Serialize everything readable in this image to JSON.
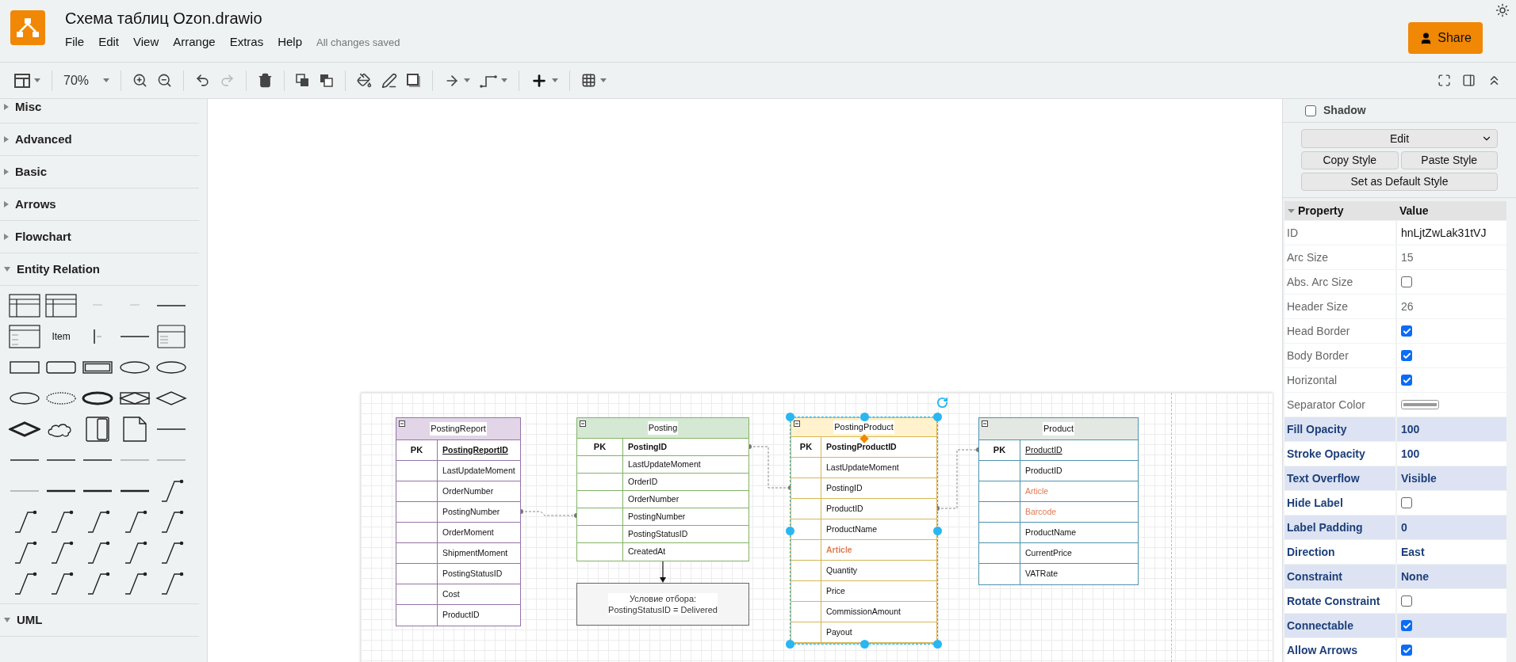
{
  "header": {
    "title": "Схема таблиц Ozon.drawio",
    "menu": [
      "File",
      "Edit",
      "View",
      "Arrange",
      "Extras",
      "Help"
    ],
    "save_status": "All changes saved",
    "share_button": "Share"
  },
  "toolbar": {
    "zoom": "70%",
    "undo": {
      "disabled": false
    },
    "redo": {
      "disabled": true
    }
  },
  "sidebar": {
    "sections": [
      {
        "label": "Misc",
        "expanded": false
      },
      {
        "label": "Advanced",
        "expanded": false
      },
      {
        "label": "Basic",
        "expanded": false
      },
      {
        "label": "Arrows",
        "expanded": false
      },
      {
        "label": "Flowchart",
        "expanded": false
      },
      {
        "label": "Entity Relation",
        "expanded": true,
        "palette_item_label": "Item"
      },
      {
        "label": "UML",
        "expanded": true
      }
    ]
  },
  "canvas": {
    "tables": [
      {
        "title": "PostingReport",
        "header": {
          "color": "#e1d5e7"
        },
        "border": {
          "color": "#9673a6"
        },
        "selected": false,
        "fields": [
          {
            "key": "PK",
            "name": "PostingReportID",
            "bold": true,
            "underline": true,
            "highlighted": false
          },
          {
            "name": "LastUpdateMoment",
            "bold": false,
            "underline": false,
            "highlighted": false
          },
          {
            "name": "OrderNumber",
            "bold": false,
            "underline": false,
            "highlighted": false
          },
          {
            "name": "PostingNumber",
            "bold": false,
            "underline": false,
            "highlighted": false
          },
          {
            "name": "OrderMoment",
            "bold": false,
            "underline": false,
            "highlighted": false
          },
          {
            "name": "ShipmentMoment",
            "bold": false,
            "underline": false,
            "highlighted": false
          },
          {
            "name": "PostingStatusID",
            "bold": false,
            "underline": false,
            "highlighted": false
          },
          {
            "name": "Cost",
            "bold": false,
            "underline": false,
            "highlighted": false
          },
          {
            "name": "ProductID",
            "bold": false,
            "underline": false,
            "highlighted": false
          }
        ]
      },
      {
        "title": "Posting",
        "header": {
          "color": "#d5e8d4"
        },
        "border": {
          "color": "#82b366"
        },
        "selected": false,
        "fields": [
          {
            "key": "PK",
            "name": "PostingID",
            "bold": true,
            "underline": false,
            "highlighted": false
          },
          {
            "name": "LastUpdateMoment",
            "bold": false,
            "underline": false,
            "highlighted": false
          },
          {
            "name": "OrderID",
            "bold": false,
            "underline": false,
            "highlighted": false
          },
          {
            "name": "OrderNumber",
            "bold": false,
            "underline": false,
            "highlighted": false
          },
          {
            "name": "PostingNumber",
            "bold": false,
            "underline": false,
            "highlighted": false
          },
          {
            "name": "PostingStatusID",
            "bold": false,
            "underline": false,
            "highlighted": false
          },
          {
            "name": "CreatedAt",
            "bold": false,
            "underline": false,
            "highlighted": false
          }
        ]
      },
      {
        "title": "PostingProduct",
        "header": {
          "color": "#fff2cc"
        },
        "border": {
          "color": "#d6b656"
        },
        "selected": true,
        "fields": [
          {
            "key": "PK",
            "name": "PostingProductID",
            "bold": true,
            "underline": false,
            "highlighted": false
          },
          {
            "name": "LastUpdateMoment",
            "bold": false,
            "underline": false,
            "highlighted": false
          },
          {
            "name": "PostingID",
            "bold": false,
            "underline": false,
            "highlighted": false
          },
          {
            "name": "ProductID",
            "bold": false,
            "underline": false,
            "highlighted": false
          },
          {
            "name": "ProductName",
            "bold": false,
            "underline": false,
            "highlighted": false
          },
          {
            "name": "Article",
            "bold": true,
            "underline": false,
            "highlighted": true
          },
          {
            "name": "Quantity",
            "bold": false,
            "underline": false,
            "highlighted": false
          },
          {
            "name": "Price",
            "bold": false,
            "underline": false,
            "highlighted": false
          },
          {
            "name": "CommissionAmount",
            "bold": false,
            "underline": false,
            "highlighted": false
          },
          {
            "name": "Payout",
            "bold": false,
            "underline": false,
            "highlighted": false
          }
        ]
      },
      {
        "title": "Product",
        "header": {
          "color": "#e3e8e3"
        },
        "border": {
          "color": "#4d93ad"
        },
        "selected": false,
        "fields": [
          {
            "key": "PK",
            "name": "ProductID",
            "bold": false,
            "underline": true,
            "highlighted": false
          },
          {
            "name": "ProductID",
            "bold": false,
            "underline": false,
            "highlighted": false
          },
          {
            "name": "Article",
            "bold": false,
            "underline": false,
            "highlighted": true
          },
          {
            "name": "Barcode",
            "bold": false,
            "underline": false,
            "highlighted": true
          },
          {
            "name": "ProductName",
            "bold": false,
            "underline": false,
            "highlighted": false
          },
          {
            "name": "CurrentPrice",
            "bold": false,
            "underline": false,
            "highlighted": false
          },
          {
            "name": "VATRate",
            "bold": false,
            "underline": false,
            "highlighted": false
          }
        ]
      }
    ],
    "condition": {
      "text": "Условие отбора:\nPostingStatusID = Delivered"
    }
  },
  "format_panel": {
    "shadow": {
      "label": "Shadow",
      "checked": false
    },
    "edit_select": "Edit",
    "buttons": [
      "Copy Style",
      "Paste Style"
    ],
    "default_button": "Set as Default Style",
    "property_header": [
      "Property",
      "Value"
    ],
    "properties": [
      {
        "name": "ID",
        "kind": "input",
        "value": "hnLjtZwLak31tVJ",
        "modified": false
      },
      {
        "name": "Arc Size",
        "kind": "text",
        "value": "15",
        "modified": false
      },
      {
        "name": "Abs. Arc Size",
        "kind": "checkbox",
        "checked": false,
        "modified": false
      },
      {
        "name": "Header Size",
        "kind": "text",
        "value": "26",
        "modified": false
      },
      {
        "name": "Head Border",
        "kind": "checkbox",
        "checked": true,
        "modified": false
      },
      {
        "name": "Body Border",
        "kind": "checkbox",
        "checked": true,
        "modified": false
      },
      {
        "name": "Horizontal",
        "kind": "checkbox",
        "checked": true,
        "modified": false
      },
      {
        "name": "Separator Color",
        "kind": "color",
        "modified": false
      },
      {
        "name": "Fill Opacity",
        "kind": "text",
        "value": "100",
        "modified": true
      },
      {
        "name": "Stroke Opacity",
        "kind": "text",
        "value": "100",
        "modified": true
      },
      {
        "name": "Text Overflow",
        "kind": "text",
        "value": "Visible",
        "modified": true
      },
      {
        "name": "Hide Label",
        "kind": "checkbox",
        "checked": false,
        "modified": true
      },
      {
        "name": "Label Padding",
        "kind": "text",
        "value": "0",
        "modified": true
      },
      {
        "name": "Direction",
        "kind": "text",
        "value": "East",
        "modified": true
      },
      {
        "name": "Constraint",
        "kind": "text",
        "value": "None",
        "modified": true
      },
      {
        "name": "Rotate Constraint",
        "kind": "checkbox",
        "checked": false,
        "modified": true
      },
      {
        "name": "Connectable",
        "kind": "checkbox",
        "checked": true,
        "modified": true
      },
      {
        "name": "Allow Arrows",
        "kind": "checkbox",
        "checked": true,
        "modified": true
      }
    ]
  }
}
